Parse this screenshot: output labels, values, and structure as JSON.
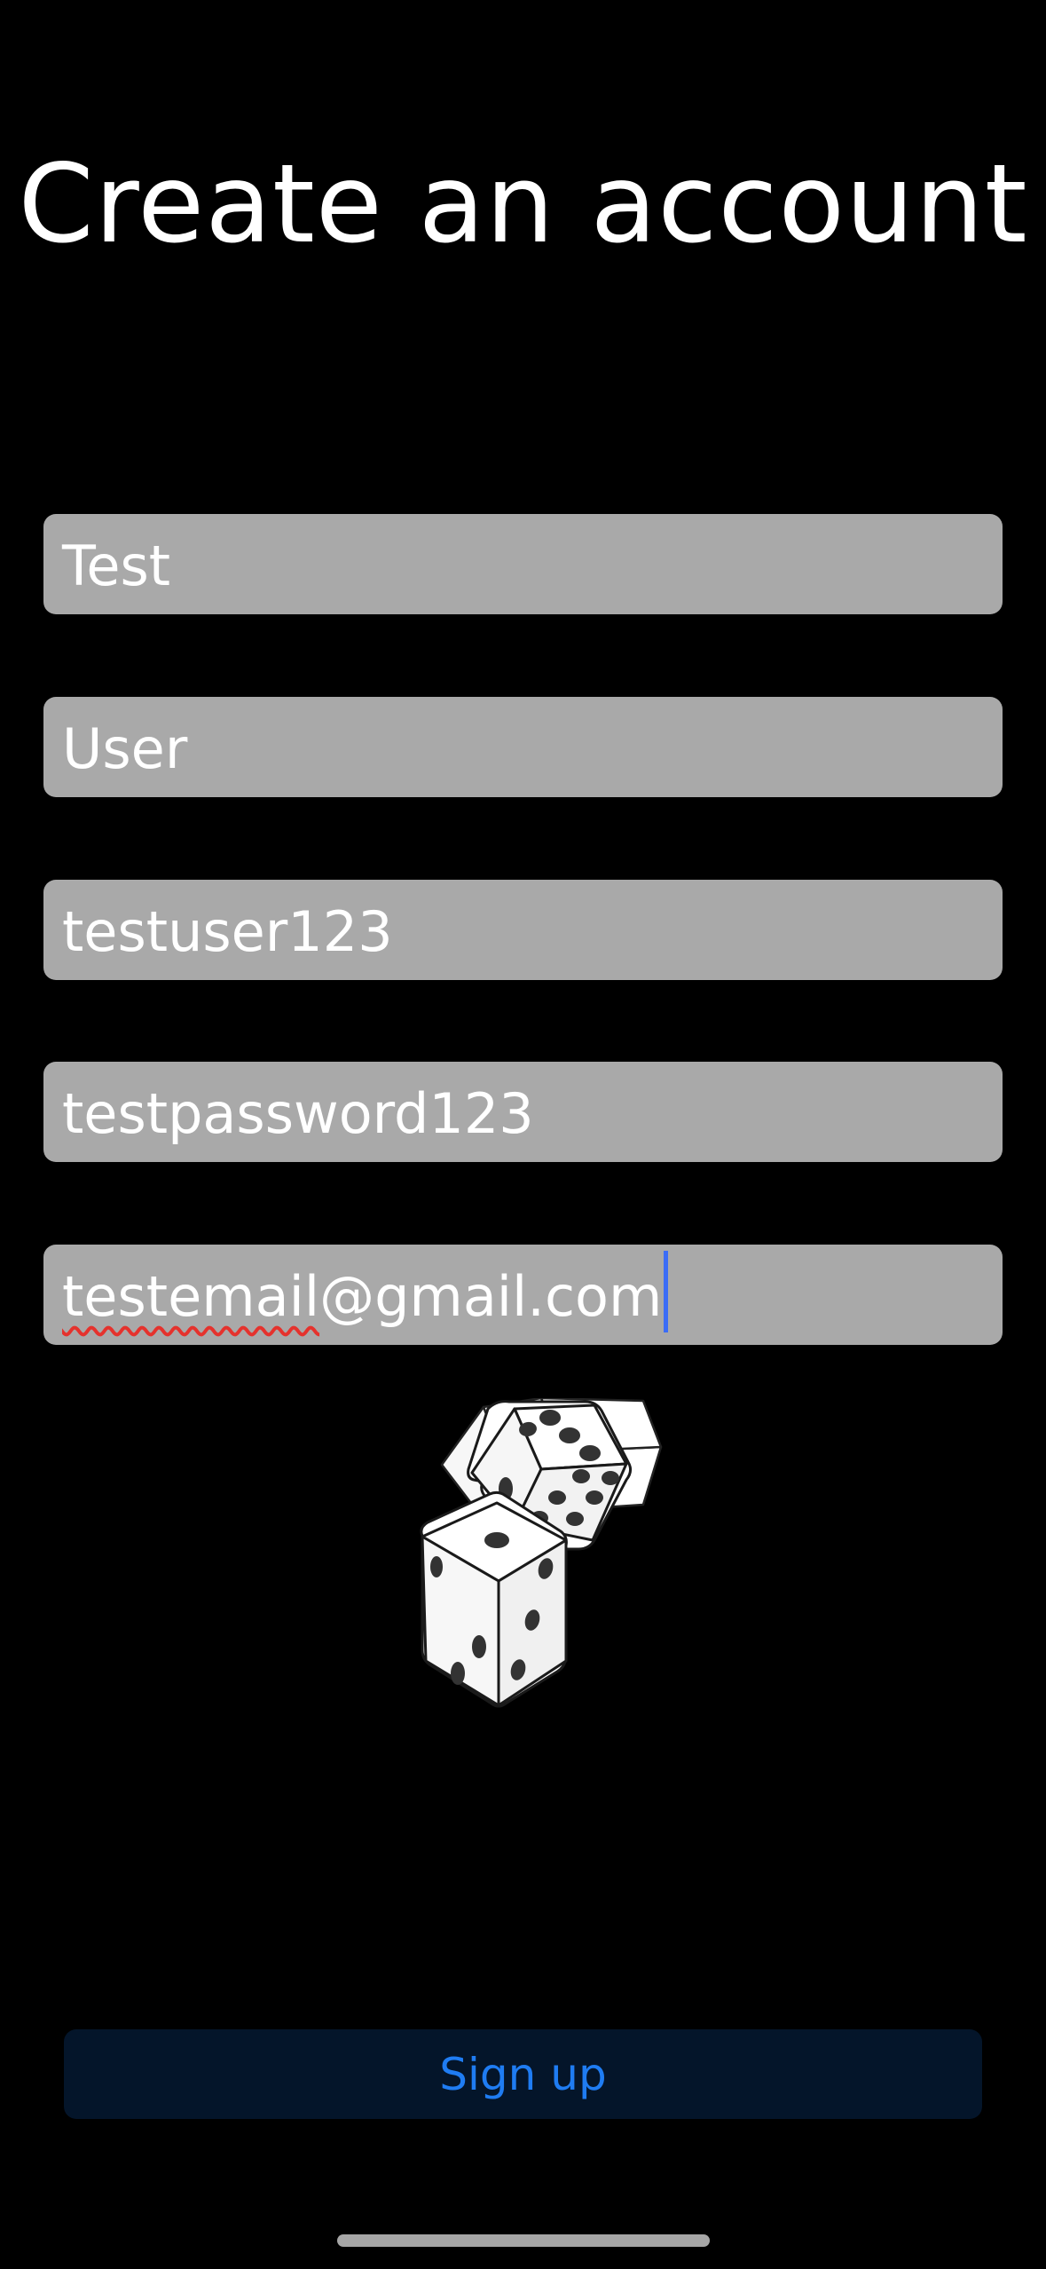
{
  "header": {
    "title": "Create an account"
  },
  "form": {
    "fields": [
      {
        "name": "first-name",
        "value": "Test"
      },
      {
        "name": "last-name",
        "value": "User"
      },
      {
        "name": "username",
        "value": "testuser123"
      },
      {
        "name": "password",
        "value": "testpassword123"
      },
      {
        "name": "email",
        "value_misspelled_part": "testemail",
        "value_rest": "@gmail.com",
        "focused": true
      }
    ]
  },
  "illustration": {
    "icon": "dice-icon"
  },
  "actions": {
    "signup_label": "Sign up"
  },
  "colors": {
    "background": "#000000",
    "field_background": "#a9a9a9",
    "button_background": "#04152a",
    "button_text": "#1f7cf2",
    "caret": "#3b6cf6",
    "spellcheck": "#e5322d"
  }
}
